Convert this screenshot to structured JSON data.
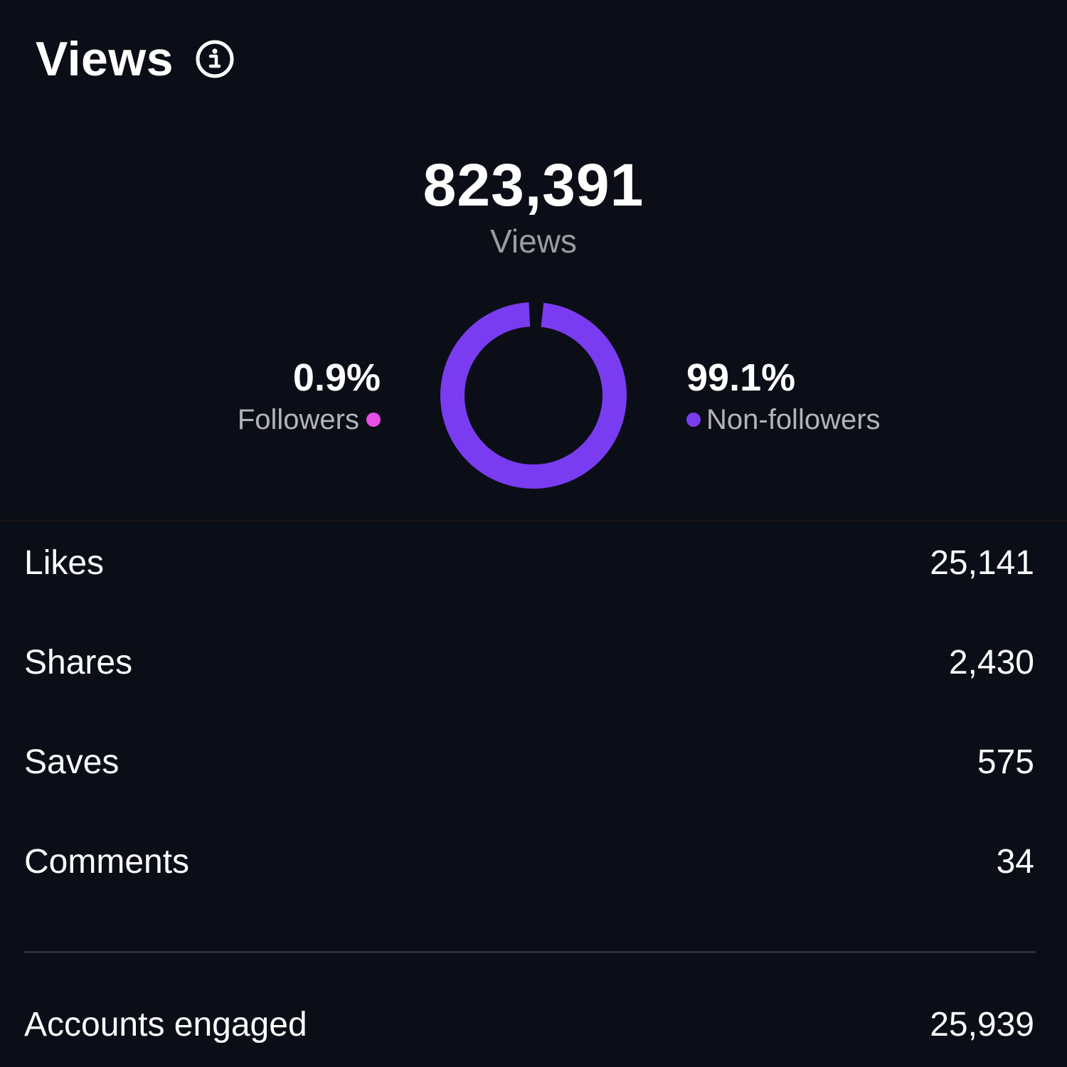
{
  "header": {
    "title": "Views",
    "info_icon": "info-circle-icon"
  },
  "total": {
    "value": "823,391",
    "label": "Views"
  },
  "split": {
    "followers": {
      "percent": "0.9%",
      "label": "Followers",
      "fraction": 0.009,
      "color": "#e94ee6"
    },
    "non_followers": {
      "percent": "99.1%",
      "label": "Non-followers",
      "fraction": 0.991,
      "color": "#7a3cf0"
    }
  },
  "metrics": [
    {
      "label": "Likes",
      "value": "25,141"
    },
    {
      "label": "Shares",
      "value": "2,430"
    },
    {
      "label": "Saves",
      "value": "575"
    },
    {
      "label": "Comments",
      "value": "34"
    }
  ],
  "accounts_engaged": {
    "label": "Accounts engaged",
    "value": "25,939"
  },
  "colors": {
    "background": "#0b0e16",
    "text_primary": "#ffffff",
    "text_secondary": "#9a9ba3",
    "divider": "#2a2f3a"
  }
}
